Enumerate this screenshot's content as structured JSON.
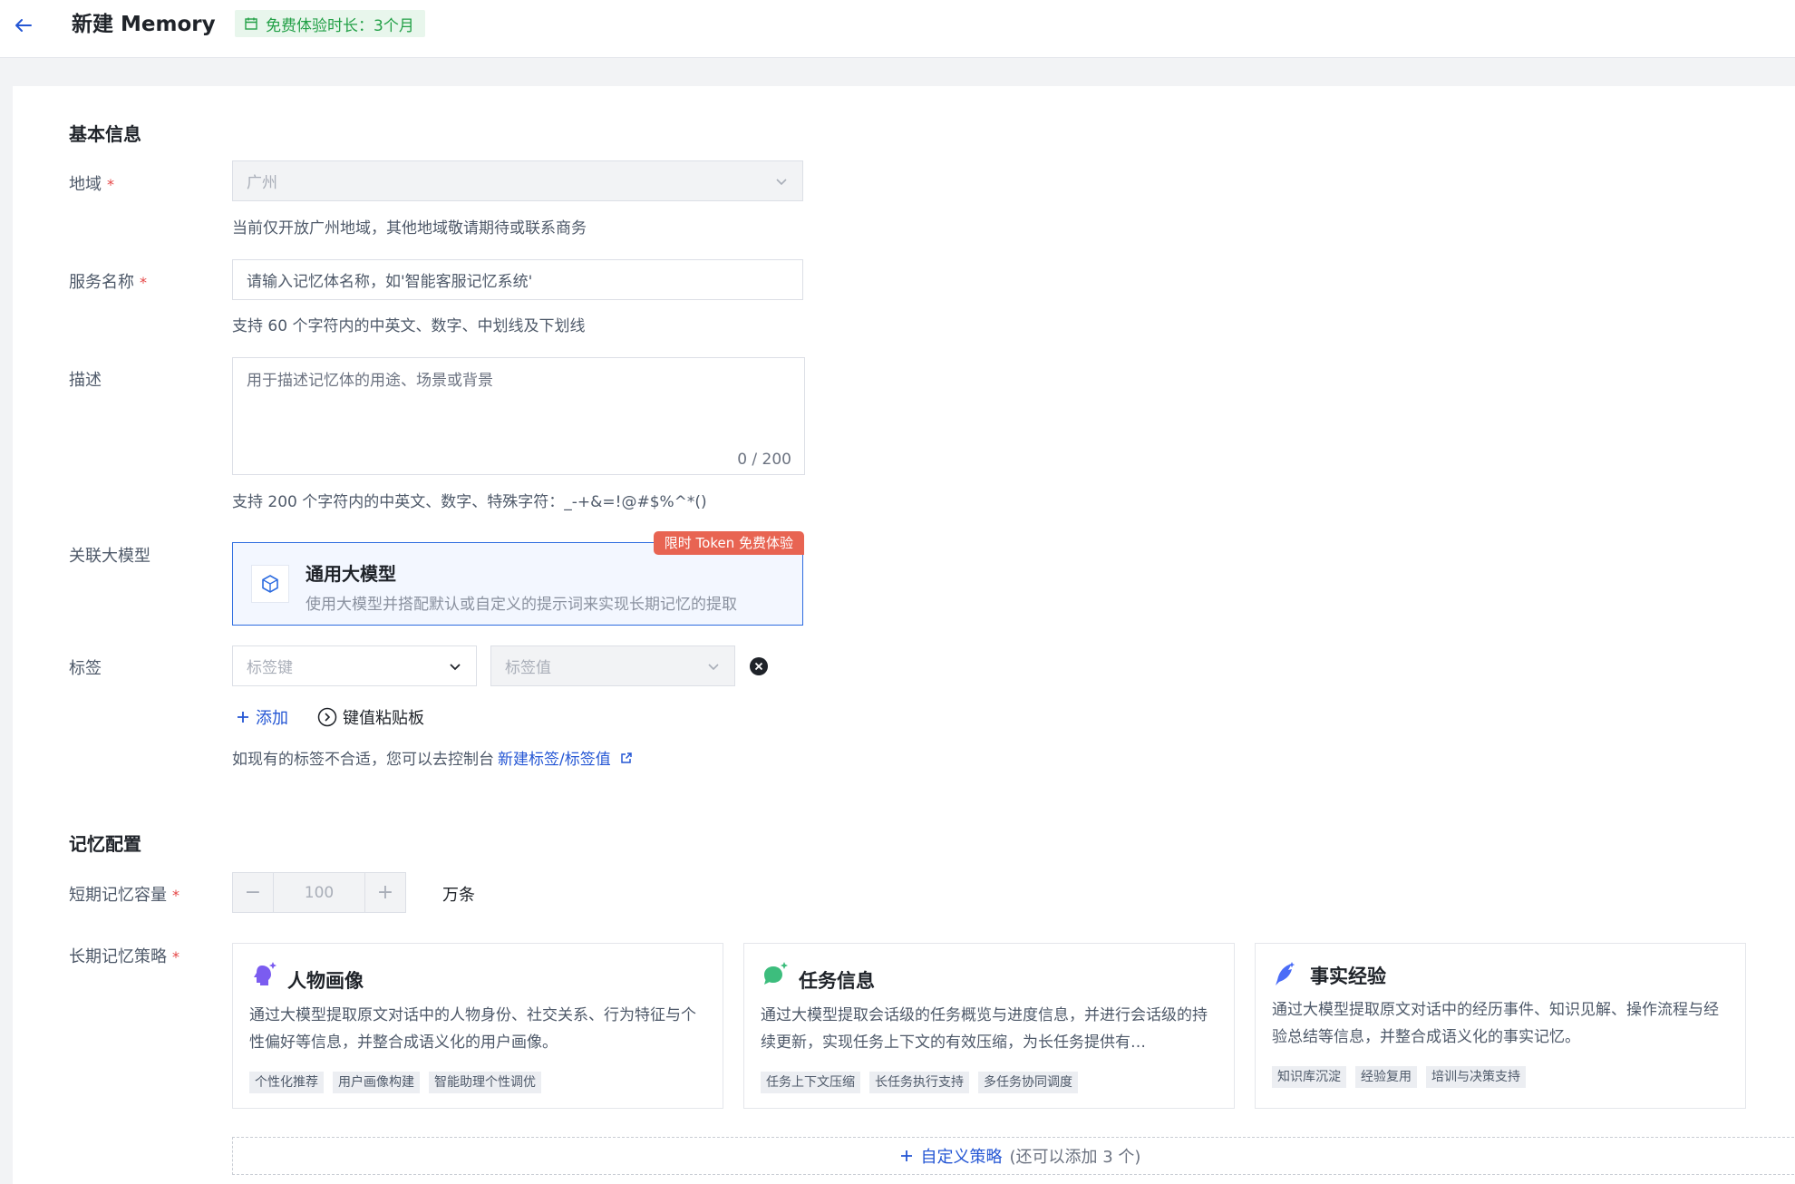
{
  "header": {
    "title": "新建 Memory",
    "trial_badge": "免费体验时长：3个月"
  },
  "basic": {
    "section_title": "基本信息",
    "region": {
      "label": "地域",
      "value": "广州",
      "help": "当前仅开放广州地域，其他地域敬请期待或联系商务"
    },
    "service_name": {
      "label": "服务名称",
      "placeholder": "请输入记忆体名称，如'智能客服记忆系统'",
      "help": "支持 60 个字符内的中英文、数字、中划线及下划线"
    },
    "description": {
      "label": "描述",
      "placeholder": "用于描述记忆体的用途、场景或背景",
      "counter": "0 / 200",
      "help": "支持 200 个字符内的中英文、数字、特殊字符：_-+&=!@#$%^*()"
    },
    "model": {
      "label": "关联大模型",
      "title": "通用大模型",
      "desc": "使用大模型并搭配默认或自定义的提示词来实现长期记忆的提取",
      "promo": "限时 Token 免费体验"
    },
    "tags": {
      "label": "标签",
      "key_placeholder": "标签键",
      "value_placeholder": "标签值",
      "add_label": "添加",
      "paste_label": "键值粘贴板",
      "hint_prefix": "如现有的标签不合适，您可以去控制台",
      "hint_link": "新建标签/标签值"
    }
  },
  "memory": {
    "section_title": "记忆配置",
    "short_term": {
      "label": "短期记忆容量",
      "value": "100",
      "unit": "万条",
      "minus": "−",
      "plus": "+"
    },
    "long_term": {
      "label": "长期记忆策略",
      "strategies": [
        {
          "title": "人物画像",
          "desc": "通过大模型提取原文对话中的人物身份、社交关系、行为特征与个性偏好等信息，并整合成语义化的用户画像。",
          "tags": [
            "个性化推荐",
            "用户画像构建",
            "智能助理个性调优"
          ],
          "icon_color": "#7b5cf0"
        },
        {
          "title": "任务信息",
          "desc": "通过大模型提取会话级的任务概览与进度信息，并进行会话级的持续更新，实现任务上下文的有效压缩，为长任务提供有…",
          "tags": [
            "任务上下文压缩",
            "长任务执行支持",
            "多任务协同调度"
          ],
          "icon_color": "#3dbd7d"
        },
        {
          "title": "事实经验",
          "desc": "通过大模型提取原文对话中的经历事件、知识见解、操作流程与经验总结等信息，并整合成语义化的事实记忆。",
          "tags": [
            "知识库沉淀",
            "经验复用",
            "培训与决策支持"
          ],
          "icon_color": "#4a6cf7"
        }
      ],
      "add_label": "自定义策略",
      "add_note": "(还可以添加 3 个)"
    }
  },
  "colors": {
    "accent": "#2456d4",
    "required": "#e54545",
    "trial_green": "#23a047",
    "promo": "#e86452"
  }
}
